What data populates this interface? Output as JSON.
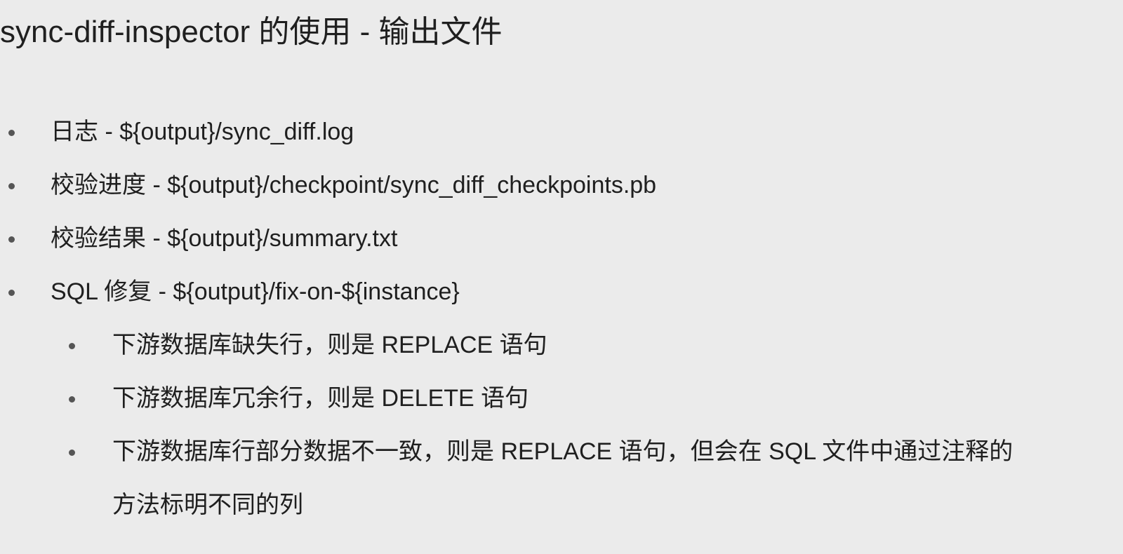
{
  "slide": {
    "title": "sync-diff-inspector 的使用 - 输出文件",
    "items": [
      "日志 - ${output}/sync_diff.log",
      "校验进度 - ${output}/checkpoint/sync_diff_checkpoints.pb",
      "校验结果 - ${output}/summary.txt",
      "SQL 修复 - ${output}/fix-on-${instance}"
    ],
    "subitems": [
      "下游数据库缺失行，则是 REPLACE 语句",
      "下游数据库冗余行，则是 DELETE 语句",
      "下游数据库行部分数据不一致，则是 REPLACE 语句，但会在 SQL 文件中通过注释的",
      "方法标明不同的列"
    ]
  }
}
